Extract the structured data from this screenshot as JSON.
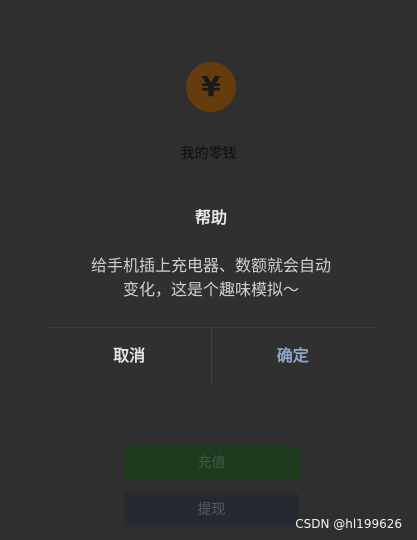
{
  "wallet": {
    "currency_symbol": "¥",
    "title": "我的零钱"
  },
  "dialog": {
    "title": "帮助",
    "message": "给手机插上充电器、数额就会自动\n变化，这是个趣味模拟～",
    "cancel_label": "取消",
    "confirm_label": "确定"
  },
  "buttons": {
    "recharge_label": "充值",
    "withdraw_label": "提现"
  },
  "watermark": {
    "text": "CSDN @hl199626"
  },
  "colors": {
    "background": "#3a3a3a",
    "modal_background": "#303030",
    "coin": "#7b4a12",
    "confirm": "#8ea6c8",
    "recharge_button": "#1f3b1f",
    "withdraw_button": "#242a30"
  },
  "icons": {
    "wallet_coin": "yuan-coin-icon"
  }
}
